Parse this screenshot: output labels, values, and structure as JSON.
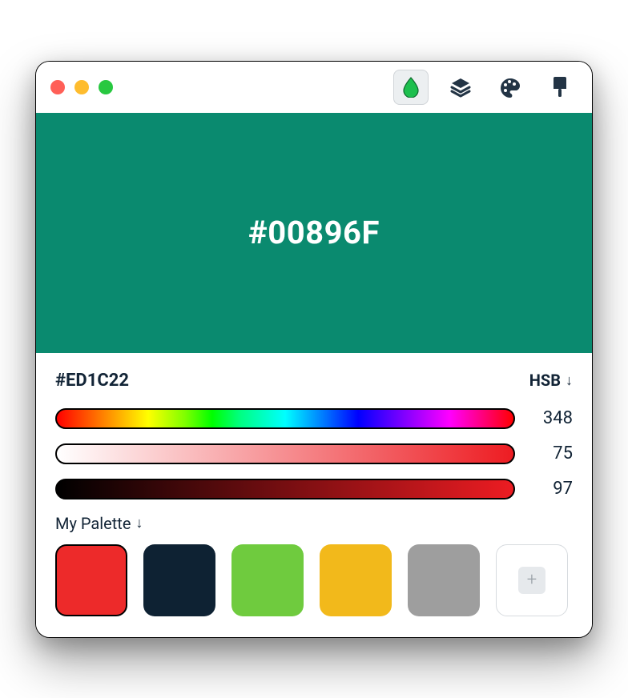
{
  "preview": {
    "hex_label": "#00896F",
    "background": "#0A8A6F"
  },
  "current": {
    "hex": "#ED1C22"
  },
  "mode": {
    "label": "HSB",
    "arrow": "↓"
  },
  "sliders": {
    "hue": "348",
    "saturation": "75",
    "brightness": "97"
  },
  "palette": {
    "title": "My Palette",
    "arrow": "↓",
    "swatches": [
      {
        "color": "#ED2A2A",
        "selected": true
      },
      {
        "color": "#0E2233",
        "selected": false
      },
      {
        "color": "#6FCB3E",
        "selected": false
      },
      {
        "color": "#F2B91B",
        "selected": false
      },
      {
        "color": "#9E9E9E",
        "selected": false
      }
    ],
    "add_glyph": "+"
  },
  "icons": {
    "drop": "drop-icon",
    "layers": "layers-icon",
    "palette": "palette-icon",
    "brush": "brush-icon"
  }
}
